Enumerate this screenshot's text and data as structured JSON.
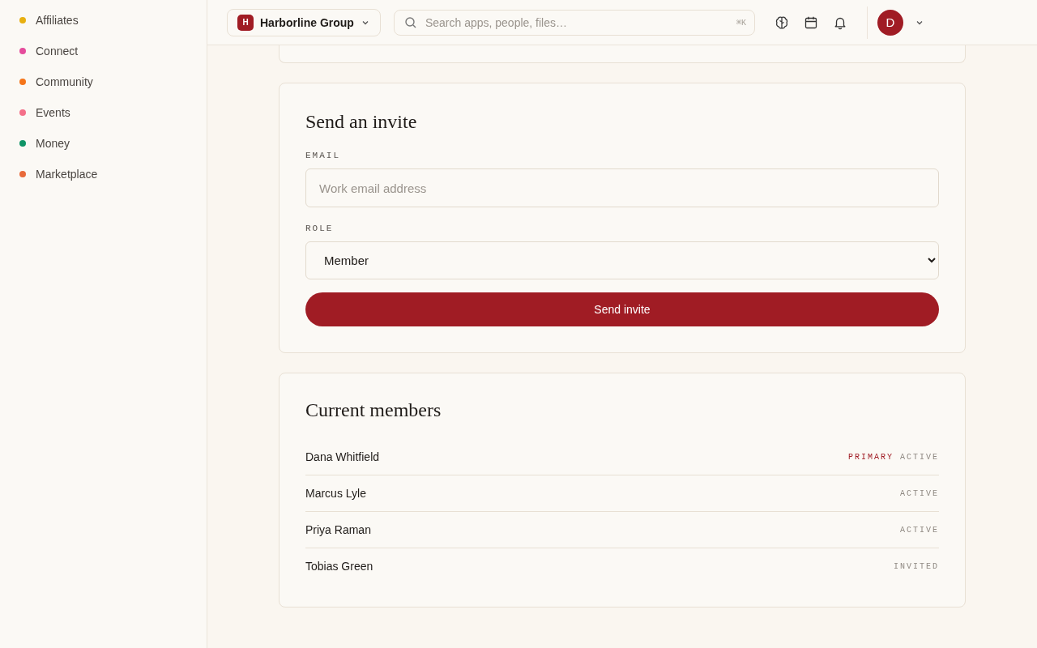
{
  "sidebar": {
    "items": [
      {
        "label": "Affiliates",
        "color": "#e8b010"
      },
      {
        "label": "Connect",
        "color": "#e54c9c"
      },
      {
        "label": "Community",
        "color": "#f5751a"
      },
      {
        "label": "Events",
        "color": "#f47089"
      },
      {
        "label": "Money",
        "color": "#0f9466"
      },
      {
        "label": "Marketplace",
        "color": "#e86a3a"
      }
    ]
  },
  "topbar": {
    "workspace": {
      "initial": "H",
      "name": "Harborline Group"
    },
    "search": {
      "placeholder": "Search apps, people, files…",
      "shortcut": "⌘K"
    },
    "avatar": "D"
  },
  "invite": {
    "title": "Send an invite",
    "email_label": "EMAIL",
    "email": {
      "placeholder": "Work email address"
    },
    "role_label": "ROLE",
    "role": "Member",
    "button": "Send invite"
  },
  "members": {
    "title": "Current members",
    "rows": [
      {
        "name": "Dana Whitfield",
        "tag": "PRIMARY",
        "status": "ACTIVE"
      },
      {
        "name": "Marcus Lyle",
        "status": "ACTIVE"
      },
      {
        "name": "Priya Raman",
        "status": "ACTIVE"
      },
      {
        "name": "Tobias Green",
        "status": "INVITED"
      }
    ]
  }
}
